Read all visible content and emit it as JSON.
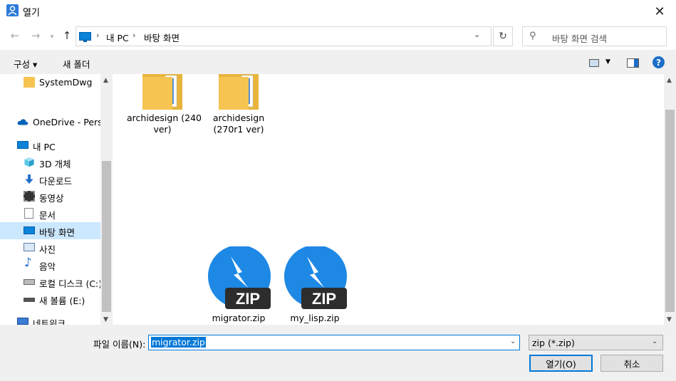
{
  "window": {
    "title": "열기"
  },
  "nav": {
    "address": {
      "crumbs": [
        "내 PC",
        "바탕 화면"
      ]
    },
    "search": {
      "placeholder": "바탕 화면 검색"
    }
  },
  "toolbar": {
    "organize": "구성 ▾",
    "new_folder": "새 폴더"
  },
  "sidebar": {
    "items": [
      {
        "label": "SystemDwg",
        "icon": "folder-icon"
      },
      {
        "label": "OneDrive - Person",
        "icon": "onedrive-cloud-icon"
      },
      {
        "label": "내 PC",
        "icon": "pc-icon"
      },
      {
        "label": "3D 개체",
        "icon": "cube-3d-icon"
      },
      {
        "label": "다운로드",
        "icon": "download-arrow-icon"
      },
      {
        "label": "동영상",
        "icon": "video-icon"
      },
      {
        "label": "문서",
        "icon": "document-icon"
      },
      {
        "label": "바탕 화면",
        "icon": "desktop-icon",
        "selected": true
      },
      {
        "label": "사진",
        "icon": "pictures-icon"
      },
      {
        "label": "음악",
        "icon": "music-note-icon"
      },
      {
        "label": "로컬 디스크 (C:)",
        "icon": "local-disk-icon"
      },
      {
        "label": "새 볼륨 (E:)",
        "icon": "drive-icon"
      },
      {
        "label": "네트워크",
        "icon": "network-icon"
      }
    ]
  },
  "files": [
    {
      "name": "archidesign (240\nver)",
      "type": "folder"
    },
    {
      "name": "archidesign\n(270r1 ver)",
      "type": "folder"
    },
    {
      "name": "migrator.zip",
      "type": "zip",
      "badge": "ZIP"
    },
    {
      "name": "my_lisp.zip",
      "type": "zip",
      "badge": "ZIP"
    }
  ],
  "bottom": {
    "filename_label": "파일 이름(N):",
    "filename_value": "migrator.zip",
    "filetype": "zip (*.zip)",
    "open": "열기(O)",
    "cancel": "취소"
  },
  "colors": {
    "accent": "#0078d7",
    "zip_blue": "#1e88e5",
    "selection": "#cce8ff",
    "folder": "#f5c451"
  }
}
